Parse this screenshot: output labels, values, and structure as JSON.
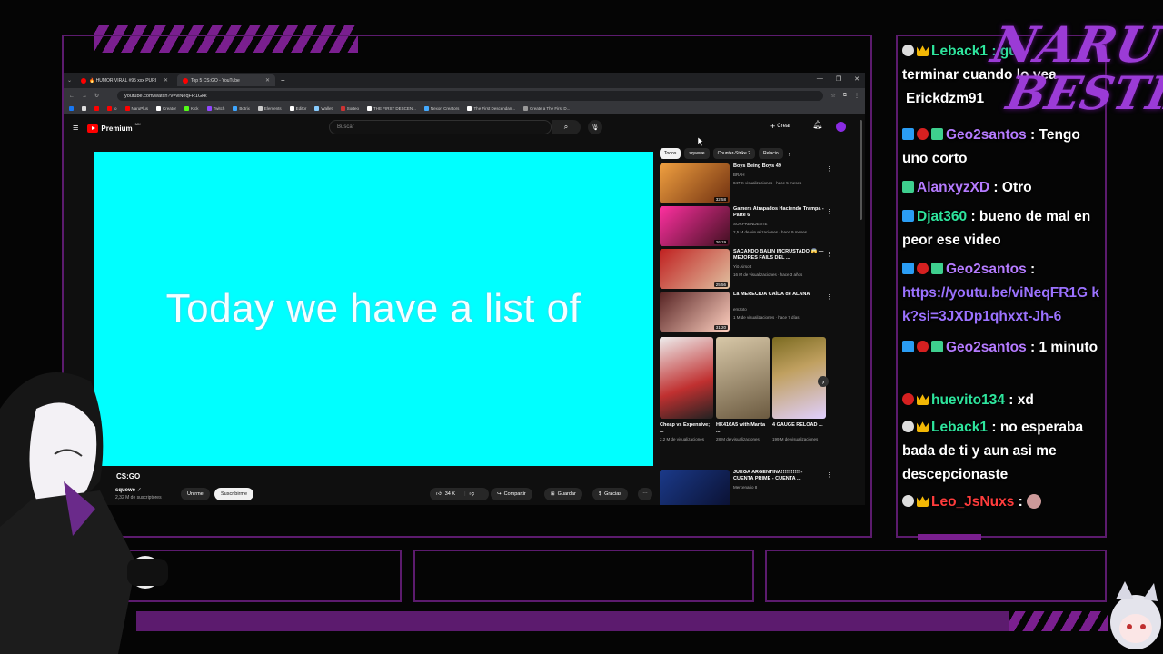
{
  "browser": {
    "tabs": [
      {
        "label": "🔥 HUMOR VIRAL #95 xxx PURI"
      },
      {
        "label": "Top 5 CS:GO - YouTube"
      }
    ],
    "url": "youtube.com/watch?v=viNeqFR1Gkk",
    "bookmarks": [
      "io",
      "NaruPlus",
      "Creator",
      "Kick",
      "Twitch",
      "Botrix",
      "Elements",
      "Editor",
      "Wallet",
      "Sorteo",
      "THE FIRST DESCEN...",
      "Nexon Creators",
      "The First Descendan...",
      "Create a The First D..."
    ]
  },
  "youtube": {
    "logo_text": "Premium",
    "logo_sup": "MX",
    "search_placeholder": "Buscar",
    "create_label": "Crear",
    "video_caption": "Today we have a list of",
    "video_title": "CS:GO",
    "channel": "squewe",
    "subscribers": "2,32 M de suscriptores",
    "unirme": "Unirme",
    "subscribe": "Suscribirme",
    "likes": "34 K",
    "share": "Compartir",
    "save": "Guardar",
    "thanks": "Gracias",
    "chips": [
      "Todos",
      "squewe",
      "Counter-Strike 2",
      "Relacio"
    ],
    "recommended": [
      {
        "title": "Boys Being Boys 49",
        "channel": "BRAH",
        "meta": "847 K visualizaciones · hace 5 meses",
        "duration": "32:58"
      },
      {
        "title": "Gamers Atrapados Haciendo Trampa - Parte 6",
        "channel": "SORPRENDENTE",
        "meta": "2,5 M de visualizaciones · hace 9 meses",
        "duration": "26:19"
      },
      {
        "title": "SACANDO BALIN INCRUSTADO 😱 — MEJORES FAILS DEL ...",
        "channel": "Yiö Airsoft",
        "meta": "16 M de visualizaciones · hace 3 años",
        "duration": "25:56"
      },
      {
        "title": "La MERECIDA CAÍDA de ALANA",
        "channel": "emzoto",
        "meta": "1 M de visualizaciones · hace 7 días",
        "duration": "31:20"
      }
    ],
    "shorts": [
      {
        "title": "Cheap vs Expensive; ...",
        "views": "2,2 M de visualizaciones"
      },
      {
        "title": "HK416A5 with Manta ...",
        "views": "28 M de visualizaciones"
      },
      {
        "title": "4 GAUGE RELOAD ...",
        "views": "199 M de visualizaciones"
      }
    ],
    "last_rec": {
      "title": "JUEGA ARGENTINA!!!!!!!!!!! - CUENTA PRIME - CUENTA ...",
      "channel": "Mercenario 8"
    }
  },
  "chat": {
    "messages": [
      {
        "user": "Leback1",
        "text": "Leback1 : gu",
        "color": "green",
        "badges": [
          "b-white",
          "b-crown"
        ]
      },
      {
        "user": "",
        "text": "terminar cuando lo vea",
        "color": "white",
        "badges": []
      },
      {
        "user": "Erickdzm91",
        "text": "Erickdzm91",
        "color": "white",
        "badges": []
      },
      {
        "user": "Geo2santos",
        "text": " : Tengo uno corto",
        "color": "purple",
        "badges": [
          "b-pred",
          "b-red",
          "b-grp"
        ]
      },
      {
        "user": "AlanxyzXD",
        "text": " : Otro",
        "color": "purple",
        "badges": [
          "b-grp"
        ]
      },
      {
        "user": "Djat360",
        "text": " : bueno de mal en peor ese video",
        "color": "green",
        "badges": [
          "b-pred"
        ]
      },
      {
        "user": "Geo2santos",
        "text": " : https://youtu.be/viNeqFR1Gkk?si=3JXDp1qhxxt-Jh-6",
        "color": "purple",
        "badges": [
          "b-pred",
          "b-red",
          "b-grp"
        ]
      },
      {
        "user": "Geo2santos",
        "text": " : 1 minuto",
        "color": "purple",
        "badges": [
          "b-pred",
          "b-red",
          "b-grp"
        ]
      },
      {
        "user": "huevito134",
        "text": " : xd",
        "color": "green",
        "badges": [
          "b-red",
          "b-crown"
        ]
      },
      {
        "user": "Leback1",
        "text": " : no esperaba bada de ti y aun asi me descepcionaste",
        "color": "green",
        "badges": [
          "b-white",
          "b-crown"
        ]
      },
      {
        "user": "Leo_JsNuxs",
        "text": " : ",
        "color": "red",
        "badges": [
          "b-white",
          "b-crown"
        ]
      }
    ]
  },
  "overlay": {
    "logo_line1": "NARU",
    "logo_line2": "BESTIA"
  },
  "colors": {
    "accent": "#7a1f8f",
    "player_bg": "#00ffff",
    "yt_red": "#ff0000"
  }
}
